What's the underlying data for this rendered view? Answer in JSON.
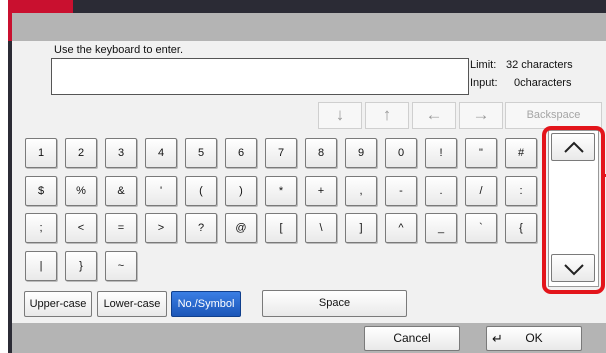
{
  "prompt": "Use the keyboard to enter.",
  "entry_value": "",
  "limit": {
    "label": "Limit:",
    "value": "32 characters"
  },
  "input": {
    "label": "Input:",
    "value": "0characters"
  },
  "nav_keys": [
    {
      "icon": "arrow-down-icon",
      "glyph": "↓"
    },
    {
      "icon": "arrow-up-icon",
      "glyph": "↑"
    },
    {
      "icon": "arrow-left-icon",
      "glyph": "←"
    },
    {
      "icon": "arrow-right-icon",
      "glyph": "→"
    }
  ],
  "backspace_label": "Backspace",
  "keys": {
    "row1": [
      "1",
      "2",
      "3",
      "4",
      "5",
      "6",
      "7",
      "8",
      "9",
      "0",
      "!",
      "\"",
      "#"
    ],
    "row2": [
      "$",
      "%",
      "&",
      "'",
      "(",
      ")",
      "*",
      "+",
      ",",
      "-",
      ".",
      "/",
      ":"
    ],
    "row3": [
      ";",
      "<",
      "=",
      ">",
      "?",
      "@",
      "[",
      "\\",
      "]",
      "^",
      "_",
      "`",
      "{"
    ],
    "row4": [
      "|",
      "}",
      "~"
    ]
  },
  "modes": [
    {
      "label": "Upper-case",
      "active": false
    },
    {
      "label": "Lower-case",
      "active": false
    },
    {
      "label": "No./Symbol",
      "active": true
    }
  ],
  "space_label": "Space",
  "cancel_label": "Cancel",
  "ok_label": "OK",
  "colors": {
    "accent_active": "#1b56b8",
    "highlight": "#e3151b",
    "titlebar": "#b4b4b4"
  }
}
